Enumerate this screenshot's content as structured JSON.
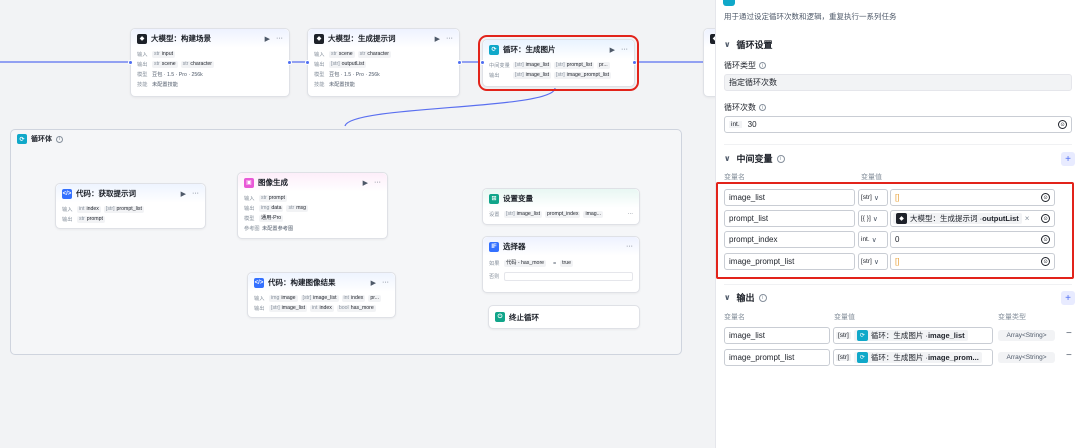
{
  "nodes": {
    "build_scene": {
      "title": "大模型：构建场景",
      "in_label": "输入",
      "out_label": "输出",
      "model_label": "模型",
      "skill_label": "技能",
      "inputs": [
        {
          "t": "str",
          "n": "input"
        }
      ],
      "outputs": [
        {
          "t": "str",
          "n": "scene"
        },
        {
          "t": "str",
          "n": "character"
        }
      ],
      "model": "豆包 · 1.5 · Pro · 256k",
      "skill": "未配置技能"
    },
    "gen_prompt": {
      "title": "大模型：生成提示词",
      "in_label": "输入",
      "out_label": "输出",
      "model_label": "模型",
      "skill_label": "技能",
      "inputs": [
        {
          "t": "str",
          "n": "scene"
        },
        {
          "t": "str",
          "n": "character"
        }
      ],
      "outputs": [
        {
          "t": "[str]",
          "n": "outputList"
        }
      ],
      "model": "豆包 · 1.5 · Pro · 256k",
      "skill": "未配置技能"
    },
    "loop": {
      "title": "循环：生成图片",
      "mid_label": "中间变量",
      "out_label": "输出",
      "mids": [
        {
          "t": "[str]",
          "n": "image_list"
        },
        {
          "t": "[str]",
          "n": "prompt_list"
        },
        {
          "t": "",
          "n": "pr..."
        }
      ],
      "outputs": [
        {
          "t": "[str]",
          "n": "image_list"
        },
        {
          "t": "[str]",
          "n": "image_prompt_list"
        }
      ]
    },
    "loop_body": {
      "title": "循环体"
    },
    "code_get": {
      "title": "代码：获取提示词",
      "in_label": "输入",
      "out_label": "输出",
      "inputs": [
        {
          "t": "int",
          "n": "index"
        },
        {
          "t": "[str]",
          "n": "prompt_list"
        }
      ],
      "outputs": [
        {
          "t": "str",
          "n": "prompt"
        }
      ]
    },
    "image_gen": {
      "title": "图像生成",
      "in_label": "输入",
      "out_label": "输出",
      "model_label": "模型",
      "ref_label": "参考图",
      "inputs": [
        {
          "t": "str",
          "n": "prompt"
        }
      ],
      "outputs": [
        {
          "t": "img",
          "n": "data"
        },
        {
          "t": "str",
          "n": "msg"
        }
      ],
      "model": "通用-Pro",
      "ref": "未配置参考图"
    },
    "code_build": {
      "title": "代码：构建图像结果",
      "in_label": "输入",
      "out_label": "输出",
      "inputs": [
        {
          "t": "img",
          "n": "image"
        },
        {
          "t": "[str]",
          "n": "image_list"
        },
        {
          "t": "int",
          "n": "index"
        },
        {
          "t": "",
          "n": "pr..."
        }
      ],
      "outputs": [
        {
          "t": "[str]",
          "n": "image_list"
        },
        {
          "t": "int",
          "n": "index"
        },
        {
          "t": "bool",
          "n": "has_more"
        }
      ]
    },
    "set_var": {
      "title": "设置变量",
      "label": "设置",
      "items": [
        {
          "t": "[str]",
          "n": "image_list"
        },
        {
          "t": "",
          "n": "prompt_index"
        },
        {
          "t": "",
          "n": "imag..."
        }
      ]
    },
    "selector": {
      "title": "选择器",
      "if_label": "如果",
      "else_label": "否则",
      "cond_left": "代码 - has_more",
      "cond_op": "=",
      "cond_right": "true"
    },
    "stop_loop": {
      "title": "终止循环"
    }
  },
  "panel": {
    "description": "用于通过设定循环次数和逻辑，重复执行一系列任务",
    "loop_settings": {
      "section": "循环设置",
      "type_label": "循环类型",
      "type_value": "指定循环次数",
      "count_label": "循环次数",
      "count_type": "int.",
      "count_value": "30"
    },
    "mid_vars": {
      "section": "中间变量",
      "col_name": "变量名",
      "col_value": "变量值",
      "rows": [
        {
          "name": "image_list",
          "type": "[str]",
          "value": "[]"
        },
        {
          "name": "prompt_list",
          "type": "[{ }]",
          "ref_prefix": "大模型：生成提示词 · ",
          "ref_bold": "outputList",
          "ref_close": "×"
        },
        {
          "name": "prompt_index",
          "type": "int.",
          "value": "0"
        },
        {
          "name": "image_prompt_list",
          "type": "[str]",
          "value": "[]"
        }
      ]
    },
    "outputs": {
      "section": "输出",
      "col_name": "变量名",
      "col_value": "变量值",
      "col_type": "变量类型",
      "rows": [
        {
          "name": "image_list",
          "type": "[str]",
          "ref_prefix": "循环：生成图片 · ",
          "ref_bold": "image_list",
          "arr": "Array<String>"
        },
        {
          "name": "image_prompt_list",
          "type": "[str]",
          "ref_prefix": "循环：生成图片 · ",
          "ref_bold": "image_prom...",
          "arr": "Array<String>"
        }
      ]
    }
  },
  "colors": {
    "accent": "#4e6ef2",
    "highlight": "#e2231a",
    "loop": "#10a8c9"
  }
}
